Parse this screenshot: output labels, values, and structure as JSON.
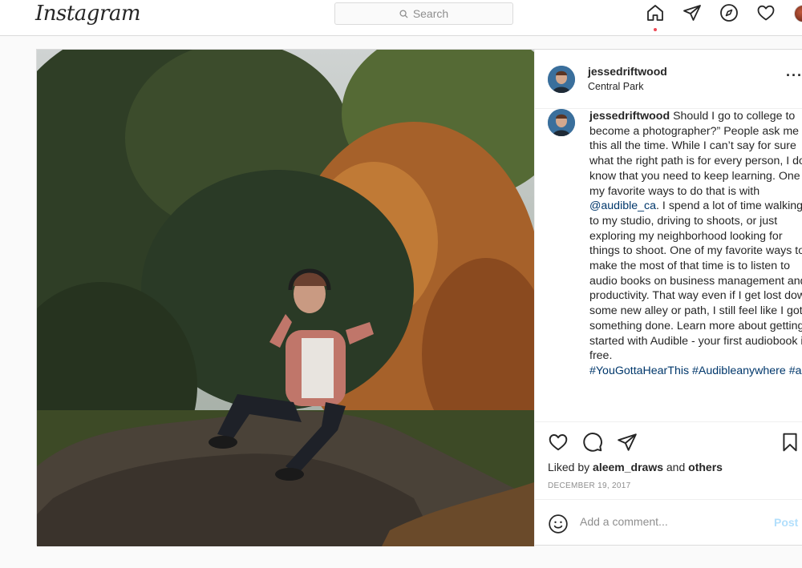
{
  "app": {
    "logo": "Instagram"
  },
  "search": {
    "placeholder": "Search"
  },
  "nav": {
    "icons": [
      "home-icon",
      "direct-icon",
      "explore-icon",
      "activity-heart-icon",
      "profile-avatar"
    ]
  },
  "colors": {
    "link": "#00376b",
    "notification_dot": "#ed4956",
    "post_button": "#b2dffc"
  },
  "post": {
    "username": "jessedriftwood",
    "location": "Central Park",
    "more": "···",
    "caption": {
      "username": "jessedriftwood",
      "text_part1": " Should I go to college to become a photographer?” People ask me this all the time. While I can’t say for sure what the right path is for every person, I do know that you need to keep learning. One of my favorite ways to do that is with ",
      "mention": "@audible_ca",
      "text_part2": ". I spend a lot of time walking to my studio, driving to shoots, or just exploring my neighborhood looking for things to shoot. One of my favorite ways to make the most of that time is to listen to audio books on business management and productivity. That way even if I get lost down some new alley or path, I still feel like I got something done. Learn more about getting started with Audible - your first audiobook is free.",
      "hashtags": "#YouGottaHearThis #Audibleanywhere #ad"
    },
    "likes": {
      "prefix": "Liked by ",
      "user": "aleem_draws",
      "middle": " and ",
      "others": "others"
    },
    "date": "December 19, 2017",
    "comment": {
      "placeholder": "Add a comment...",
      "post_label": "Post"
    }
  }
}
